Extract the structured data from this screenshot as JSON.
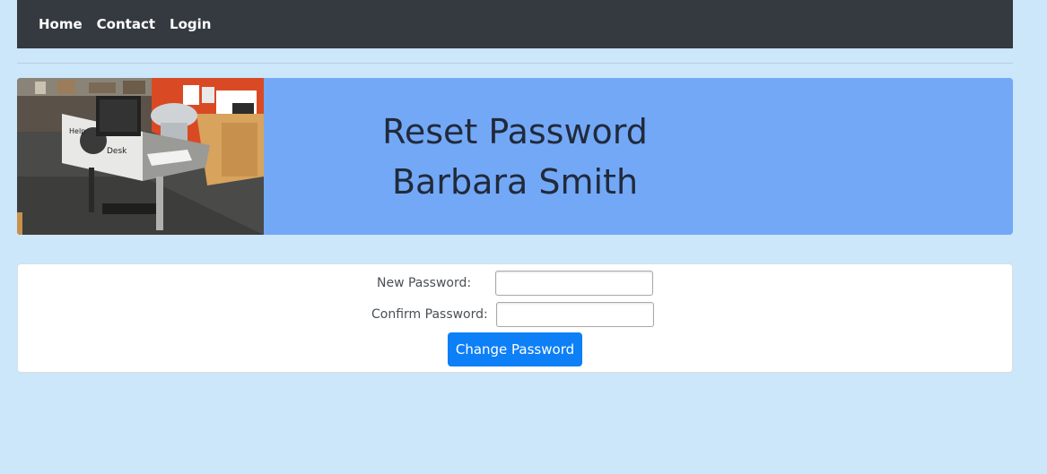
{
  "nav": {
    "items": [
      {
        "label": "Home"
      },
      {
        "label": "Contact"
      },
      {
        "label": "Login"
      }
    ]
  },
  "banner": {
    "title": "Reset Password",
    "name": "Barbara Smith",
    "image_alt": "help-desk-photo",
    "background_color": "#73a8f7"
  },
  "form": {
    "new_password_label": "New Password:",
    "confirm_password_label": "Confirm Password:",
    "new_password_value": "",
    "confirm_password_value": "",
    "submit_label": "Change Password",
    "submit_color": "#0d7ff7"
  },
  "colors": {
    "page_background": "#cce6fa",
    "navbar_background": "#343a40"
  }
}
